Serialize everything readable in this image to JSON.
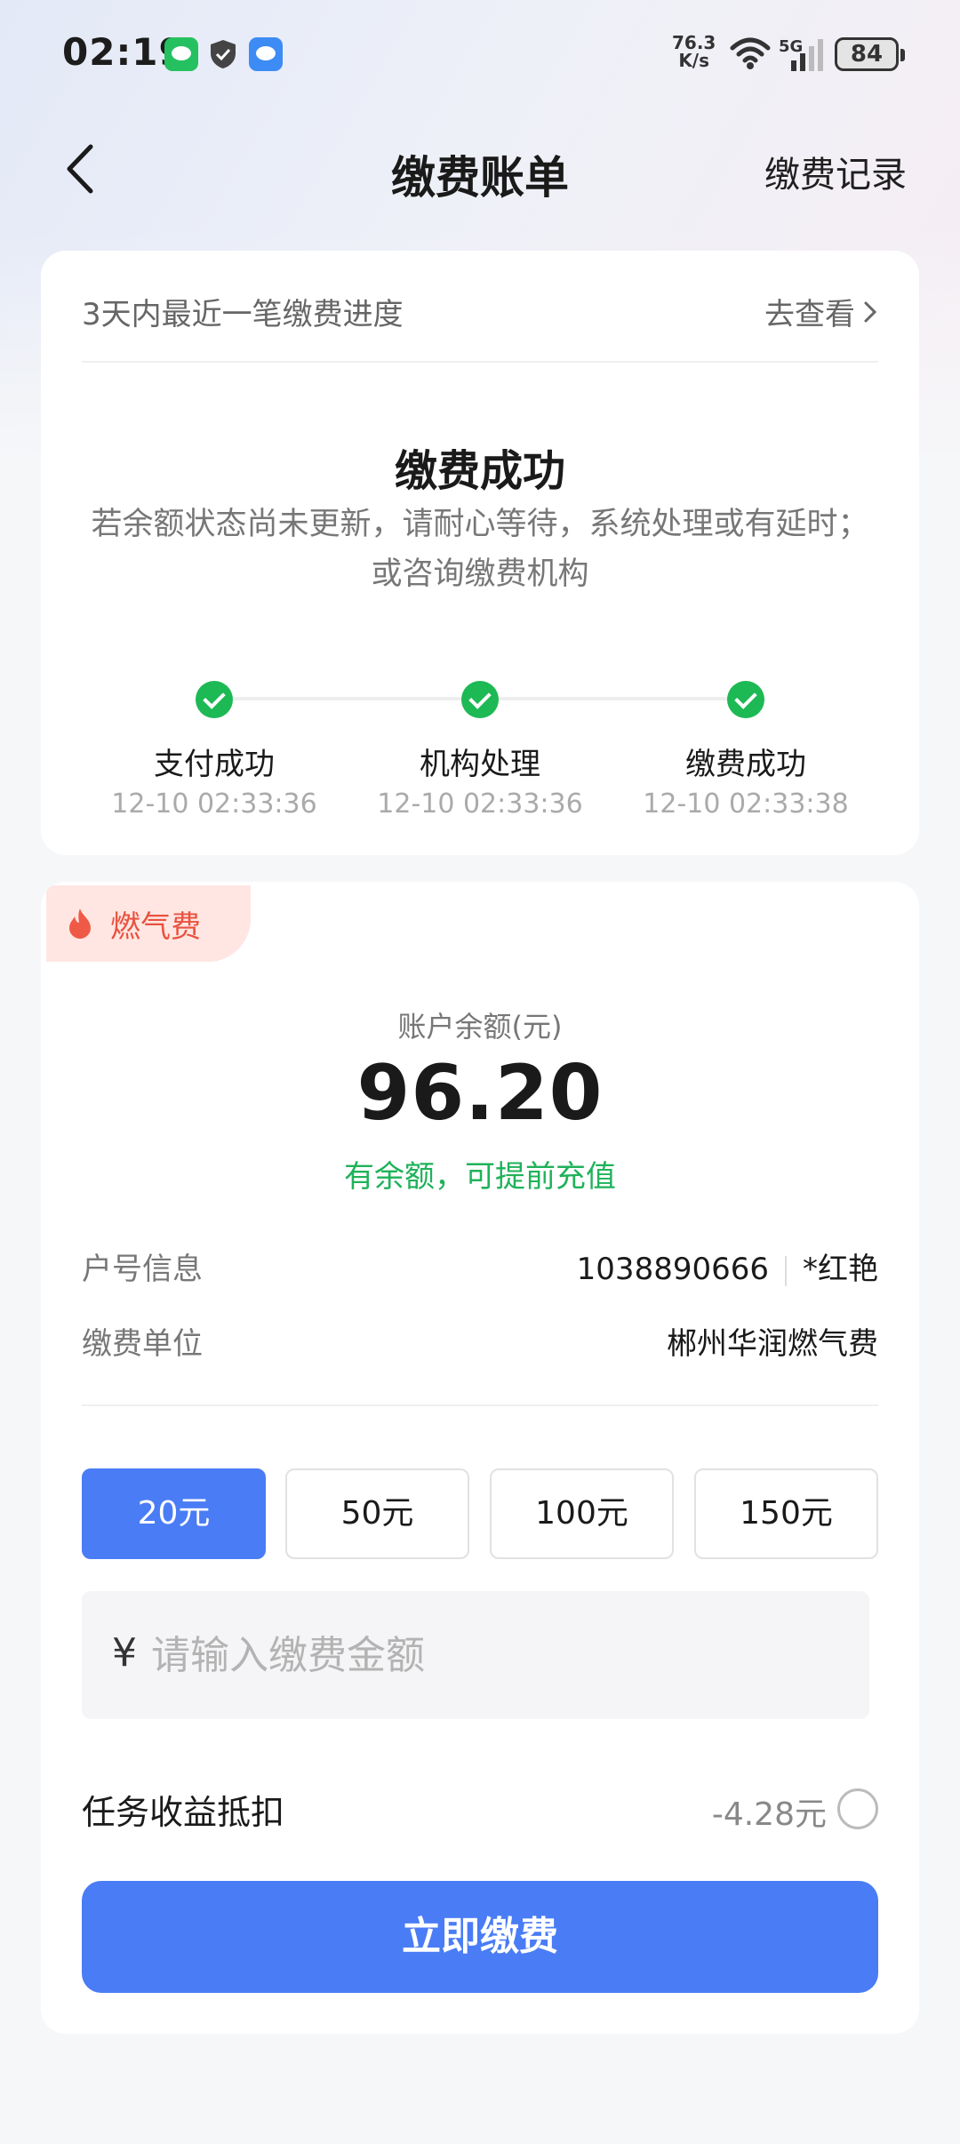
{
  "status_bar": {
    "time": "02:19",
    "net_speed_value": "76.3",
    "net_speed_unit": "K/s",
    "battery": "84",
    "signal_label": "5G"
  },
  "nav": {
    "title": "缴费账单",
    "right_link": "缴费记录"
  },
  "progress": {
    "header_text": "3天内最近一笔缴费进度",
    "header_link": "去查看",
    "title": "缴费成功",
    "description": "若余额状态尚未更新，请耐心等待，系统处理或有延时；或咨询缴费机构",
    "steps": [
      {
        "label": "支付成功",
        "time": "12-10 02:33:36"
      },
      {
        "label": "机构处理",
        "time": "12-10 02:33:36"
      },
      {
        "label": "缴费成功",
        "time": "12-10 02:33:38"
      }
    ]
  },
  "bill": {
    "tag": "燃气费",
    "balance_label": "账户余额(元)",
    "balance_value": "96.20",
    "balance_tip": "有余额，可提前充值",
    "account_label": "户号信息",
    "account_number": "1038890666",
    "account_name": "*红艳",
    "unit_label": "缴费单位",
    "unit_value": "郴州华润燃气费",
    "amount_options": [
      "20元",
      "50元",
      "100元",
      "150元"
    ],
    "selected_amount_index": 0,
    "currency_symbol": "¥",
    "amount_placeholder": "请输入缴费金额",
    "deduct_label": "任务收益抵扣",
    "deduct_value": "-4.28元",
    "pay_button": "立即缴费"
  },
  "colors": {
    "primary": "#4a7cf5",
    "success": "#1db954",
    "tag_bg": "#ffe6e2",
    "tag_text": "#e9523f"
  }
}
